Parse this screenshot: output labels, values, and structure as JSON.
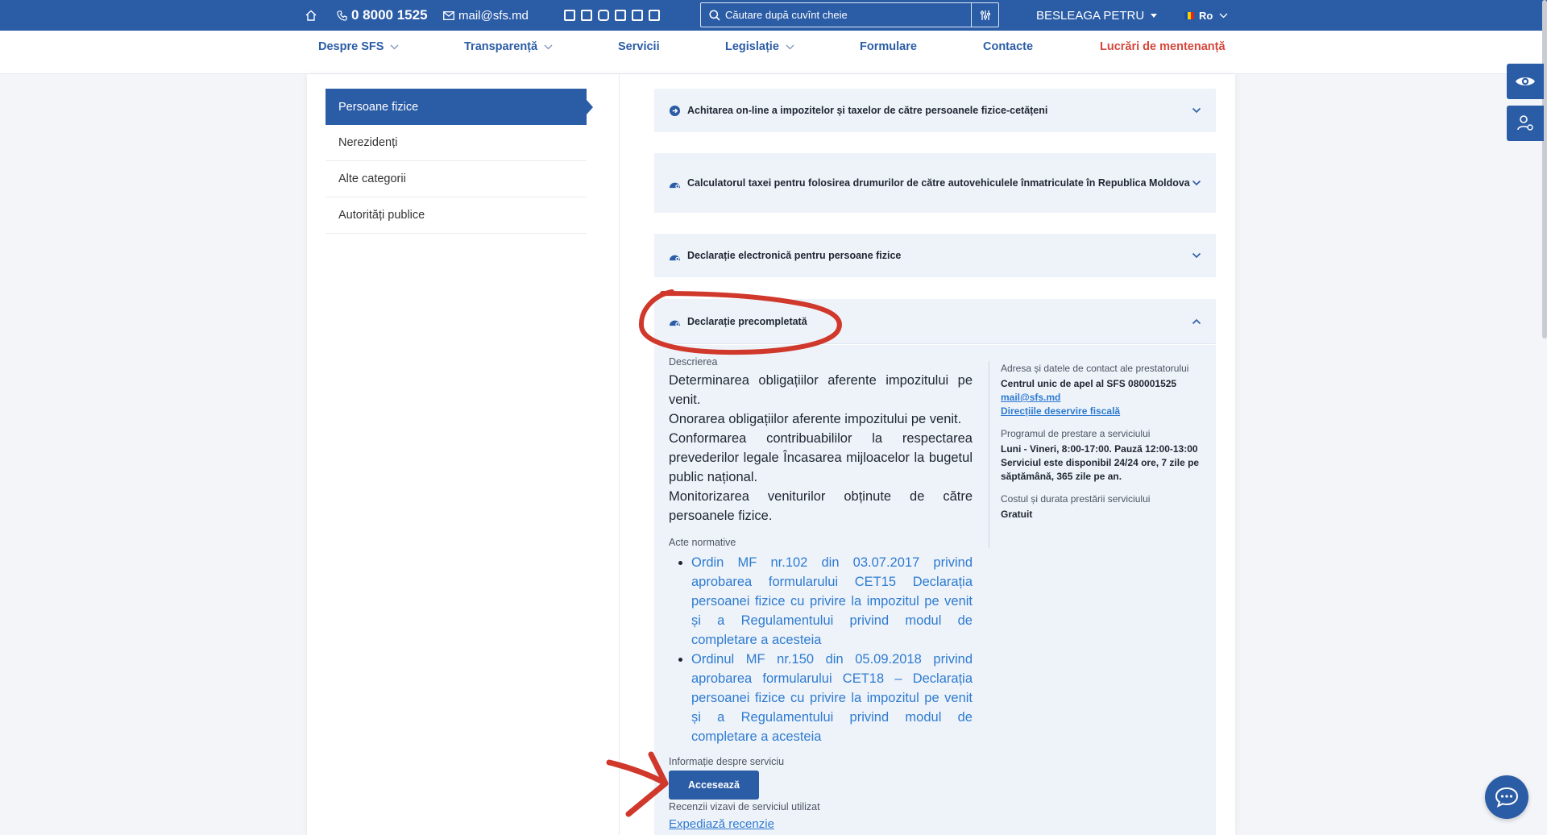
{
  "topbar": {
    "phone": "0 8000 1525",
    "email": "mail@sfs.md",
    "search_placeholder": "Căutare după cuvînt cheie",
    "user_name": "BESLEAGA PETRU",
    "language": "Ro",
    "social_icons": [
      "rss-icon",
      "facebook-icon",
      "instagram-icon",
      "linkedin-icon",
      "telegram-icon",
      "youtube-icon"
    ]
  },
  "nav": {
    "items": [
      {
        "label": "Despre SFS",
        "dropdown": true
      },
      {
        "label": "Transparență",
        "dropdown": true
      },
      {
        "label": "Servicii",
        "dropdown": false
      },
      {
        "label": "Legislație",
        "dropdown": true
      },
      {
        "label": "Formulare",
        "dropdown": false
      },
      {
        "label": "Contacte",
        "dropdown": false
      },
      {
        "label": "Lucrări de mentenanță",
        "dropdown": false
      }
    ]
  },
  "sidebar": {
    "items": [
      {
        "label": "Persoane fizice",
        "active": true
      },
      {
        "label": "Nerezidenți",
        "active": false
      },
      {
        "label": "Alte categorii",
        "active": false
      },
      {
        "label": "Autorități publice",
        "active": false
      }
    ]
  },
  "services": [
    {
      "title": "Achitarea on-line a impozitelor și taxelor de către persoanele fizice-cetățeni",
      "expanded": false
    },
    {
      "title": "Calculatorul taxei pentru folosirea drumurilor de către autovehiculele înmatriculate în Republica Moldova",
      "expanded": false
    },
    {
      "title": "Declarație electronică pentru persoane fizice",
      "expanded": false
    },
    {
      "title": "Declarație precompletată",
      "expanded": true
    }
  ],
  "detail": {
    "description_label": "Descrierea",
    "description": [
      "Determinarea obligațiilor aferente impozitului pe venit.",
      "Onorarea obligațiilor aferente impozitului pe venit.",
      "Conformarea contribuabililor la respectarea prevederilor legale Încasarea mijloacelor la bugetul public național.",
      "Monitorizarea veniturilor obținute de către persoanele fizice."
    ],
    "acts_label": "Acte normative",
    "acts": [
      "Ordin MF nr.102 din 03.07.2017 privind aprobarea formularului CET15 Declarația persoanei fizice cu privire la impozitul pe venit și a Regulamentului privind modul de completare a acesteia",
      "Ordinul MF nr.150 din 05.09.2018 privind aprobarea formularului CET18 – Declarația persoanei fizice cu privire la impozitul pe venit și a Regulamentului privind modul de completare a acesteia"
    ],
    "service_info_label": "Informație despre serviciu",
    "access_button": "Accesează",
    "reviews_label": "Recenzii vizavi de serviciul utilizat",
    "feedback_link": "Expediază recenzie",
    "contact_label": "Adresa și datele de contact ale prestatorului",
    "contact_center": "Centrul unic de apel al SFS 080001525",
    "contact_email": "mail@sfs.md",
    "contact_directions": "Direcțiile deservire fiscală",
    "schedule_label": "Programul de prestare a serviciului",
    "schedule_hours": "Luni - Vineri, 8:00-17:00. Pauză 12:00-13:00",
    "schedule_availability": "Serviciul este disponibil 24/24 ore, 7 zile pe săptămână, 365 zile pe an.",
    "cost_label": "Costul și durata prestării serviciului",
    "cost_value": "Gratuit"
  },
  "colors": {
    "brand": "#2b5ca6",
    "link": "#2e7bd0",
    "maintenance": "#d6463b",
    "annotation": "#d0382b",
    "accordion_bg": "#eef3fa"
  }
}
